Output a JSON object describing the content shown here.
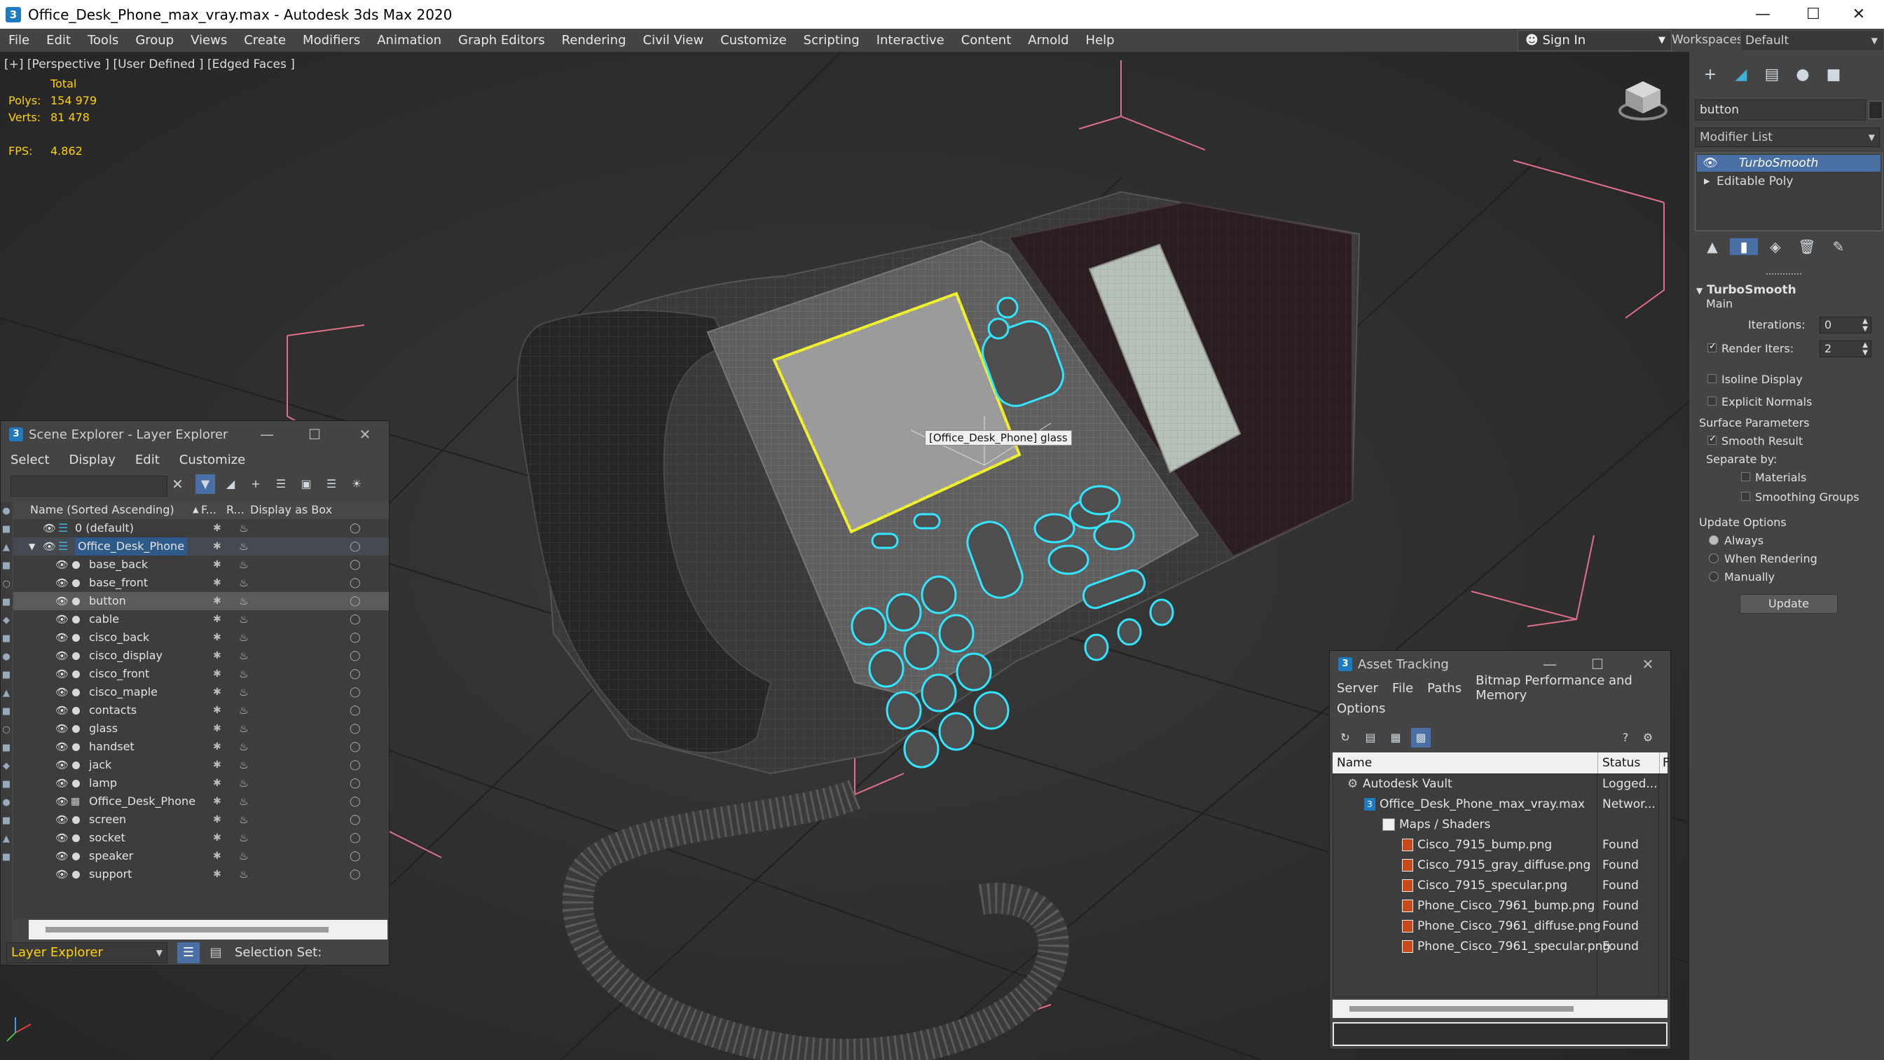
{
  "window": {
    "title": "Office_Desk_Phone_max_vray.max - Autodesk 3ds Max 2020",
    "controls": [
      "—",
      "☐",
      "✕"
    ]
  },
  "menubar": {
    "items": [
      "File",
      "Edit",
      "Tools",
      "Group",
      "Views",
      "Create",
      "Modifiers",
      "Animation",
      "Graph Editors",
      "Rendering",
      "Civil View",
      "Customize",
      "Scripting",
      "Interactive",
      "Content",
      "Arnold",
      "Help"
    ],
    "signin": "Sign In",
    "workspaces_label": "Workspaces:",
    "workspace_value": "Default"
  },
  "viewport": {
    "label": "[+] [Perspective ] [User Defined ] [Edged Faces ]",
    "stats": {
      "total_label": "Total",
      "polys_label": "Polys:",
      "polys_value": "154 979",
      "verts_label": "Verts:",
      "verts_value": "81 478",
      "fps_label": "FPS:",
      "fps_value": "4.862"
    },
    "tooltip": "[Office_Desk_Phone] glass"
  },
  "scene_explorer": {
    "title": "Scene Explorer - Layer Explorer",
    "menu": [
      "Select",
      "Display",
      "Edit",
      "Customize"
    ],
    "columns": {
      "name": "Name (Sorted Ascending)",
      "f": "F...",
      "r": "R...",
      "box": "Display as Box"
    },
    "layer_root": "0 (default)",
    "group": "Office_Desk_Phone",
    "items": [
      "base_back",
      "base_front",
      "button",
      "cable",
      "cisco_back",
      "cisco_display",
      "cisco_front",
      "cisco_maple",
      "contacts",
      "glass",
      "handset",
      "jack",
      "lamp",
      "Office_Desk_Phone",
      "screen",
      "socket",
      "speaker",
      "support"
    ],
    "selected_item": "button",
    "footer_dropdown": "Layer Explorer",
    "selection_set_label": "Selection Set:"
  },
  "command_panel": {
    "search_value": "button",
    "modifier_list": "Modifier List",
    "stack": [
      "TurboSmooth",
      "Editable Poly"
    ],
    "rollout_title": "TurboSmooth",
    "main_label": "Main",
    "iterations_label": "Iterations:",
    "iterations_value": "0",
    "render_iters_label": "Render Iters:",
    "render_iters_value": "2",
    "isoline_label": "Isoline Display",
    "explicit_normals_label": "Explicit Normals",
    "surface_params_label": "Surface Parameters",
    "smooth_result_label": "Smooth Result",
    "separate_by_label": "Separate by:",
    "materials_label": "Materials",
    "smoothing_groups_label": "Smoothing Groups",
    "update_options_label": "Update Options",
    "always_label": "Always",
    "when_rendering_label": "When Rendering",
    "manually_label": "Manually",
    "update_button": "Update"
  },
  "asset_tracking": {
    "title": "Asset Tracking",
    "menu": [
      "Server",
      "File",
      "Paths",
      "Bitmap Performance and Memory"
    ],
    "menu2": "Options",
    "col_name": "Name",
    "col_status": "Status",
    "col_extra": "F",
    "rows": [
      {
        "name": "Autodesk Vault",
        "status": "Logged..."
      },
      {
        "name": "Office_Desk_Phone_max_vray.max",
        "status": "Networ..."
      },
      {
        "name": "Maps / Shaders",
        "status": ""
      },
      {
        "name": "Cisco_7915_bump.png",
        "status": "Found"
      },
      {
        "name": "Cisco_7915_gray_diffuse.png",
        "status": "Found"
      },
      {
        "name": "Cisco_7915_specular.png",
        "status": "Found"
      },
      {
        "name": "Phone_Cisco_7961_bump.png",
        "status": "Found"
      },
      {
        "name": "Phone_Cisco_7961_diffuse.png",
        "status": "Found"
      },
      {
        "name": "Phone_Cisco_7961_specular.png",
        "status": "Found"
      }
    ]
  },
  "colors": {
    "selection_cyan": "#33e6ff",
    "selection_yellow": "#f2f22a",
    "stat_yellow": "#ffd200",
    "ui_gray": "#444444",
    "highlight_blue": "#4a6fa5"
  }
}
